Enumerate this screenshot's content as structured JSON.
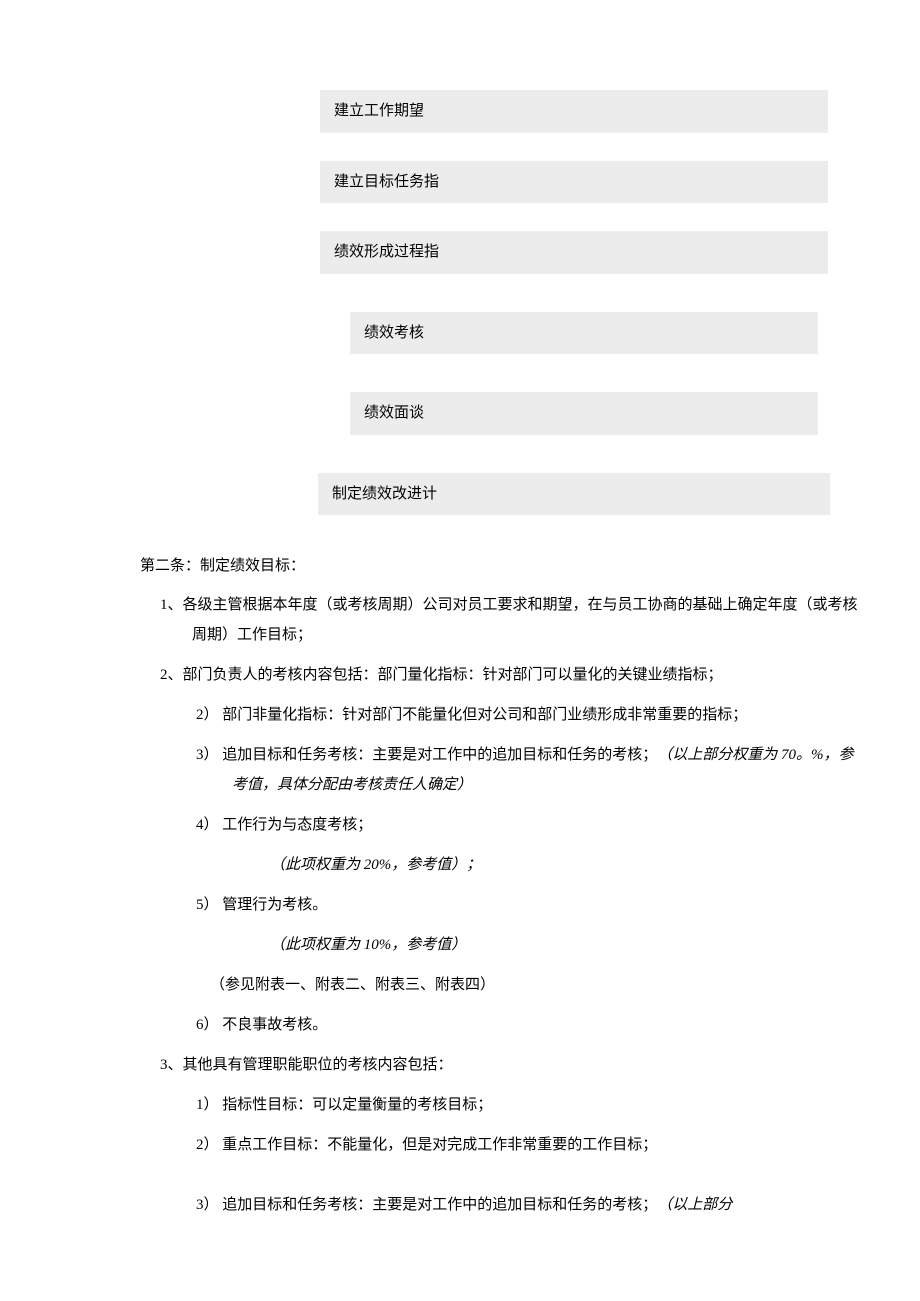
{
  "boxes": {
    "b1": "建立工作期望",
    "b2": "建立目标任务指",
    "b3": "绩效形成过程指",
    "b4": "绩效考核",
    "b5": "绩效面谈",
    "b6": "制定绩效改进计"
  },
  "heading": "第二条：制定绩效目标：",
  "item1": "1、各级主管根据本年度（或考核周期）公司对员工要求和期望，在与员工协商的基础上确定年度（或考核周期）工作目标；",
  "item2_lead": "2、部门负责人的考核内容包括：部门量化指标：针对部门可以量化的关键业绩指标；",
  "item2_2": "2） 部门非量化指标：针对部门不能量化但对公司和部门业绩形成非常重要的指标；",
  "item2_3_text": "3） 追加目标和任务考核：主要是对工作中的追加目标和任务的考核；",
  "item2_3_italic": "（以上部分权重为 70。%，参考值，具体分配由考核责任人确定）",
  "item2_4": "4） 工作行为与态度考核；",
  "item2_4_note": "（此项权重为 20%，参考值）；",
  "item2_5": "5） 管理行为考核。",
  "item2_5_note": "（此项权重为 10%，参考值）",
  "item2_ref": "（参见附表一、附表二、附表三、附表四）",
  "item2_6": "6） 不良事故考核。",
  "item3_lead": "3、其他具有管理职能职位的考核内容包括：",
  "item3_1": "1） 指标性目标：可以定量衡量的考核目标；",
  "item3_2": "2） 重点工作目标：不能量化，但是对完成工作非常重要的工作目标；",
  "item3_3_text": "3） 追加目标和任务考核：主要是对工作中的追加目标和任务的考核；",
  "item3_3_italic": "（以上部分"
}
